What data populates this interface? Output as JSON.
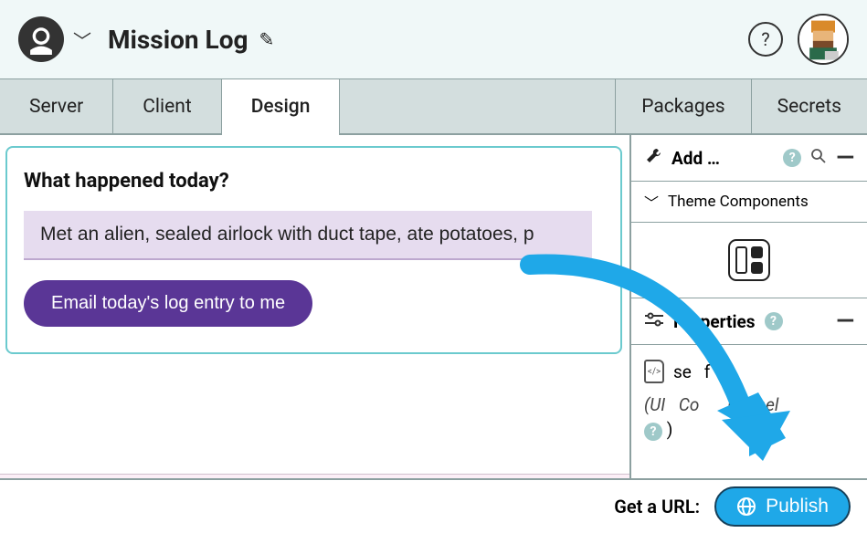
{
  "header": {
    "title": "Mission Log"
  },
  "tabs": {
    "left": [
      "Server",
      "Client",
      "Design"
    ],
    "active_index": 2,
    "right": [
      "Packages",
      "Secrets"
    ]
  },
  "form": {
    "label": "What happened today?",
    "input_value": "Met an alien, sealed airlock with duct tape, ate potatoes, p",
    "button_label": "Email today's log entry to me"
  },
  "breadcrumb": {
    "label": "self (UI)"
  },
  "sidebar": {
    "add_label": "Add …",
    "theme_label": "Theme Components",
    "properties_label": "Properties",
    "self_name": "self",
    "self_type_prefix": "(UI",
    "self_type_mid": "Co",
    "self_type_suffix": "nPanel"
  },
  "bottombar": {
    "get_url_label": "Get a URL:",
    "publish_label": "Publish"
  }
}
